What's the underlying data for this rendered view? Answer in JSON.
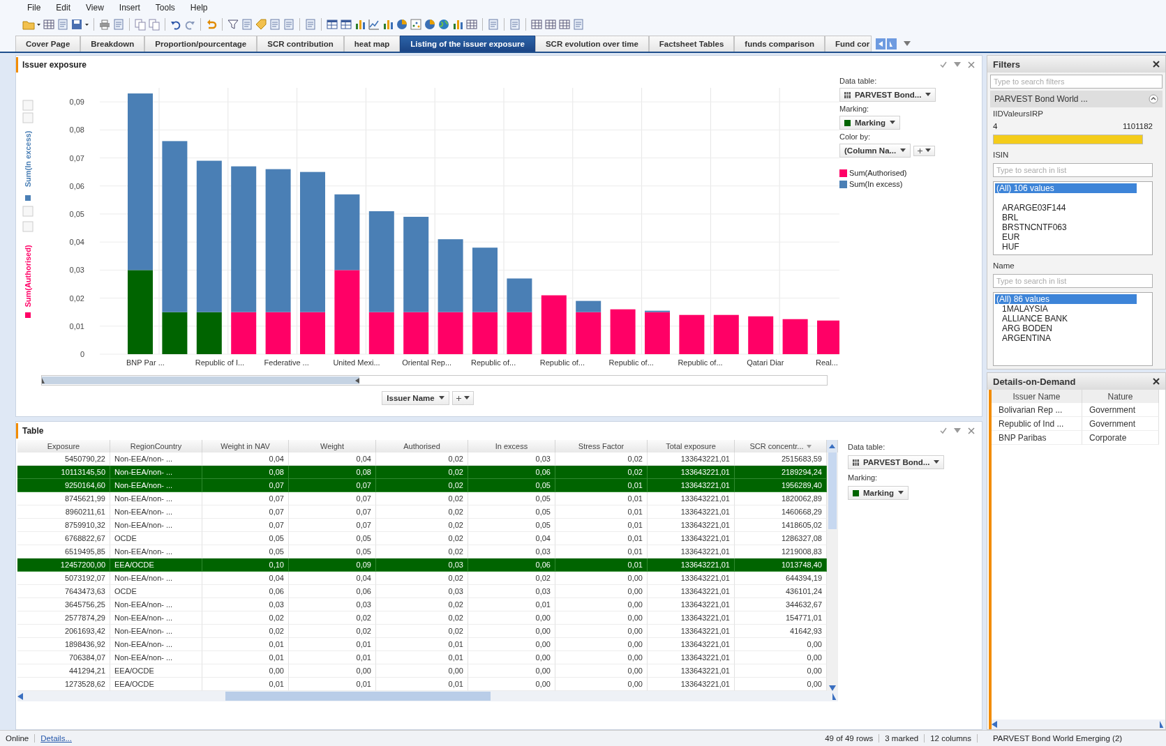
{
  "menu": [
    "File",
    "Edit",
    "View",
    "Insert",
    "Tools",
    "Help"
  ],
  "tabs": [
    {
      "label": "Cover Page",
      "selected": false
    },
    {
      "label": "Breakdown",
      "selected": false
    },
    {
      "label": "Proportion/pourcentage",
      "selected": false
    },
    {
      "label": "SCR contribution",
      "selected": false
    },
    {
      "label": "heat map",
      "selected": false
    },
    {
      "label": "Listing of the issuer exposure",
      "selected": true
    },
    {
      "label": "SCR evolution over time",
      "selected": false
    },
    {
      "label": "Factsheet Tables",
      "selected": false
    },
    {
      "label": "funds comparison",
      "selected": false
    },
    {
      "label": "Fund cor",
      "selected": false
    }
  ],
  "chart_panel": {
    "title": "Issuer exposure",
    "axis_titles": [
      {
        "text": "Sum(Authorised)",
        "color": "#ff0066"
      },
      {
        "text": "Sum(In excess)",
        "color": "#4a7fb5"
      }
    ],
    "chart_data": {
      "type": "bar",
      "stacked": true,
      "grid": true,
      "ylim": [
        0,
        0.095
      ],
      "categories": [
        "BNP Par ...",
        null,
        "Republic of I...",
        null,
        "Federative ...",
        null,
        "United Mexi...",
        null,
        "Oriental Rep...",
        null,
        "Republic of...",
        null,
        "Republic of...",
        null,
        "Republic of...",
        null,
        "Republic of...",
        null,
        "Qatari Diar",
        null,
        "Real..."
      ],
      "yticks": [
        {
          "value": 0,
          "label": "0"
        },
        {
          "value": 0.01,
          "label": "0,01"
        },
        {
          "value": 0.02,
          "label": "0,02"
        },
        {
          "value": 0.03,
          "label": "0,03"
        },
        {
          "value": 0.04,
          "label": "0,04"
        },
        {
          "value": 0.05,
          "label": "0,05"
        },
        {
          "value": 0.06,
          "label": "0,06"
        },
        {
          "value": 0.07,
          "label": "0,07"
        },
        {
          "value": 0.08,
          "label": "0,08"
        },
        {
          "value": 0.09,
          "label": "0,09"
        }
      ],
      "series": [
        {
          "name": "Sum(Authorised)",
          "color": "#ff0066",
          "values": [
            null,
            null,
            null,
            0.015,
            0.015,
            0.015,
            0.03,
            0.015,
            0.015,
            0.015,
            0.015,
            0.015,
            0.021,
            0.015,
            0.016,
            0.015,
            0.014,
            0.014,
            0.0135,
            0.0125,
            0.012
          ]
        },
        {
          "name": "Marking",
          "color": "#006400",
          "values": [
            0.03,
            0.015,
            0.015,
            null,
            null,
            null,
            null,
            null,
            null,
            null,
            null,
            null,
            null,
            null,
            null,
            null,
            null,
            null,
            null,
            null,
            null
          ]
        },
        {
          "name": "Sum(In excess)",
          "color": "#4a7fb5",
          "values": [
            0.063,
            0.061,
            0.054,
            0.052,
            0.051,
            0.05,
            0.027,
            0.036,
            0.034,
            0.026,
            0.023,
            0.012,
            0,
            0.004,
            0,
            0.0005,
            0,
            0,
            0,
            0,
            0
          ]
        }
      ]
    },
    "x_axis_selector": "Issuer Name",
    "legend": {
      "data_table_label": "Data table:",
      "data_table": "PARVEST  Bond...",
      "marking_label": "Marking:",
      "color_by_label": "Color by:",
      "color_by": "(Column Na..."
    }
  },
  "table_panel": {
    "title": "Table",
    "columns": [
      "Exposure",
      "RegionCountry",
      "Weight in NAV",
      "Weight",
      "Authorised",
      "In excess",
      "Stress Factor",
      "Total exposure",
      "SCR concentr..."
    ],
    "rows": [
      {
        "marked": false,
        "cells": [
          "5450790,22",
          "Non-EEA/non- ...",
          "0,04",
          "0,04",
          "0,02",
          "0,03",
          "0,02",
          "133643221,01",
          "2515683,59"
        ]
      },
      {
        "marked": true,
        "cells": [
          "10113145,50",
          "Non-EEA/non- ...",
          "0,08",
          "0,08",
          "0,02",
          "0,06",
          "0,02",
          "133643221,01",
          "2189294,24"
        ]
      },
      {
        "marked": true,
        "cells": [
          "9250164,60",
          "Non-EEA/non- ...",
          "0,07",
          "0,07",
          "0,02",
          "0,05",
          "0,01",
          "133643221,01",
          "1956289,40"
        ]
      },
      {
        "marked": false,
        "cells": [
          "8745621,99",
          "Non-EEA/non- ...",
          "0,07",
          "0,07",
          "0,02",
          "0,05",
          "0,01",
          "133643221,01",
          "1820062,89"
        ]
      },
      {
        "marked": false,
        "cells": [
          "8960211,61",
          "Non-EEA/non- ...",
          "0,07",
          "0,07",
          "0,02",
          "0,05",
          "0,01",
          "133643221,01",
          "1460668,29"
        ]
      },
      {
        "marked": false,
        "cells": [
          "8759910,32",
          "Non-EEA/non- ...",
          "0,07",
          "0,07",
          "0,02",
          "0,05",
          "0,01",
          "133643221,01",
          "1418605,02"
        ]
      },
      {
        "marked": false,
        "cells": [
          "6768822,67",
          "OCDE",
          "0,05",
          "0,05",
          "0,02",
          "0,04",
          "0,01",
          "133643221,01",
          "1286327,08"
        ]
      },
      {
        "marked": false,
        "cells": [
          "6519495,85",
          "Non-EEA/non- ...",
          "0,05",
          "0,05",
          "0,02",
          "0,03",
          "0,01",
          "133643221,01",
          "1219008,83"
        ]
      },
      {
        "marked": true,
        "cells": [
          "12457200,00",
          "EEA/OCDE",
          "0,10",
          "0,09",
          "0,03",
          "0,06",
          "0,01",
          "133643221,01",
          "1013748,40"
        ]
      },
      {
        "marked": false,
        "cells": [
          "5073192,07",
          "Non-EEA/non- ...",
          "0,04",
          "0,04",
          "0,02",
          "0,02",
          "0,00",
          "133643221,01",
          "644394,19"
        ]
      },
      {
        "marked": false,
        "cells": [
          "7643473,63",
          "OCDE",
          "0,06",
          "0,06",
          "0,03",
          "0,03",
          "0,00",
          "133643221,01",
          "436101,24"
        ]
      },
      {
        "marked": false,
        "cells": [
          "3645756,25",
          "Non-EEA/non- ...",
          "0,03",
          "0,03",
          "0,02",
          "0,01",
          "0,00",
          "133643221,01",
          "344632,67"
        ]
      },
      {
        "marked": false,
        "cells": [
          "2577874,29",
          "Non-EEA/non- ...",
          "0,02",
          "0,02",
          "0,02",
          "0,00",
          "0,00",
          "133643221,01",
          "154771,01"
        ]
      },
      {
        "marked": false,
        "cells": [
          "2061693,42",
          "Non-EEA/non- ...",
          "0,02",
          "0,02",
          "0,02",
          "0,00",
          "0,00",
          "133643221,01",
          "41642,93"
        ]
      },
      {
        "marked": false,
        "cells": [
          "1898436,92",
          "Non-EEA/non- ...",
          "0,01",
          "0,01",
          "0,01",
          "0,00",
          "0,00",
          "133643221,01",
          "0,00"
        ]
      },
      {
        "marked": false,
        "cells": [
          "706384,07",
          "Non-EEA/non- ...",
          "0,01",
          "0,01",
          "0,01",
          "0,00",
          "0,00",
          "133643221,01",
          "0,00"
        ]
      },
      {
        "marked": false,
        "cells": [
          "441294,21",
          "EEA/OCDE",
          "0,00",
          "0,00",
          "0,00",
          "0,00",
          "0,00",
          "133643221,01",
          "0,00"
        ]
      },
      {
        "marked": false,
        "cells": [
          "1273528,62",
          "EEA/OCDE",
          "0,01",
          "0,01",
          "0,01",
          "0,00",
          "0,00",
          "133643221,01",
          "0,00"
        ]
      }
    ],
    "legend": {
      "data_table_label": "Data table:",
      "data_table": "PARVEST  Bond...",
      "marking_label": "Marking:",
      "marking": "Marking"
    }
  },
  "filters": {
    "title": "Filters",
    "search_placeholder": "Type to search filters",
    "group": "PARVEST Bond World ...",
    "range": {
      "label": "IIDValeursIRP",
      "min": "4",
      "max": "1101182",
      "level": 1
    },
    "lists": [
      {
        "label": "ISIN",
        "placeholder": "Type to search in list",
        "items": [
          {
            "text": "(All) 106 values",
            "selected": true
          },
          {
            "text": "ARARGE03F144",
            "selected": false
          },
          {
            "text": "BRL",
            "selected": false
          },
          {
            "text": "BRSTNCNTF063",
            "selected": false
          },
          {
            "text": "EUR",
            "selected": false
          },
          {
            "text": "HUF",
            "selected": false
          }
        ]
      },
      {
        "label": "Name",
        "placeholder": "Type to search in list",
        "items": [
          {
            "text": "(All) 86 values",
            "selected": true
          },
          {
            "text": "1MALAYSIA",
            "selected": false
          },
          {
            "text": "ALLIANCE BANK",
            "selected": false
          },
          {
            "text": "ARG BODEN",
            "selected": false
          },
          {
            "text": "ARGENTINA",
            "selected": false
          }
        ]
      }
    ]
  },
  "details": {
    "title": "Details-on-Demand",
    "columns": [
      "Issuer Name",
      "Nature"
    ],
    "rows": [
      [
        "Bolivarian Rep ...",
        "Government"
      ],
      [
        "Republic of Ind ...",
        "Government"
      ],
      [
        "BNP Paribas",
        "Corporate"
      ]
    ]
  },
  "status_bar": {
    "state": "Online",
    "link": "Details...",
    "rows": "49 of 49 rows",
    "marked": "3 marked",
    "columns": "12 columns",
    "data_table": "PARVEST Bond World Emerging (2)"
  }
}
